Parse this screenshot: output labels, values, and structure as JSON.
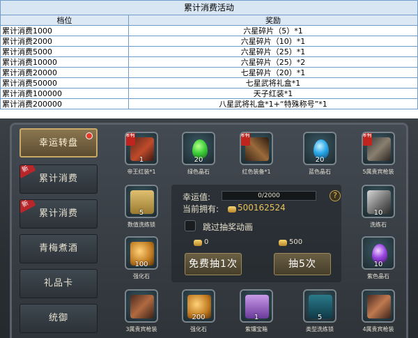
{
  "table": {
    "title": "累计消费活动",
    "headers": [
      "档位",
      "奖励"
    ],
    "rows": [
      {
        "tier": "累计消费1000",
        "reward": "六星碎片（5）*1"
      },
      {
        "tier": "累计消费2000",
        "reward": "六星碎片（10）*1"
      },
      {
        "tier": "累计消费5000",
        "reward": "六星碎片（25）*1"
      },
      {
        "tier": "累计消费10000",
        "reward": "六星碎片（25）*2"
      },
      {
        "tier": "累计消费20000",
        "reward": "七星碎片（20）*1"
      },
      {
        "tier": "累计消费50000",
        "reward": "七星武将礼盒*1"
      },
      {
        "tier": "累计消费100000",
        "reward": "天子红装*1"
      },
      {
        "tier": "累计消费200000",
        "reward": "八星武将礼盒*1+“特殊称号”*1"
      }
    ]
  },
  "sidebar": {
    "items": [
      {
        "label": "幸运转盘",
        "new": false
      },
      {
        "label": "累计消费",
        "new": true
      },
      {
        "label": "累计消费",
        "new": true
      },
      {
        "label": "青梅煮酒",
        "new": false
      },
      {
        "label": "礼品卡",
        "new": false
      },
      {
        "label": "统御",
        "new": false
      }
    ]
  },
  "slots": [
    {
      "name": "帝王红装*1",
      "count": "1",
      "limited": true,
      "tag": "稀有"
    },
    {
      "name": "绿色晶石",
      "count": "20",
      "limited": false,
      "tag": ""
    },
    {
      "name": "红色装备*1",
      "count": "",
      "limited": true,
      "tag": "稀有"
    },
    {
      "name": "蓝色晶石",
      "count": "20",
      "limited": false,
      "tag": ""
    },
    {
      "name": "5属贵宾枪装",
      "count": "",
      "limited": true,
      "tag": "稀有"
    },
    {
      "name": "数值洗练锁",
      "count": "5",
      "limited": false,
      "tag": ""
    },
    {
      "name": "洗练石",
      "count": "10",
      "limited": false,
      "tag": ""
    },
    {
      "name": "强化石",
      "count": "100",
      "limited": false,
      "tag": ""
    },
    {
      "name": "紫色晶石",
      "count": "10",
      "limited": false,
      "tag": ""
    },
    {
      "name": "3属贵宾枪装",
      "count": "",
      "limited": false,
      "tag": ""
    },
    {
      "name": "强化石",
      "count": "200",
      "limited": false,
      "tag": ""
    },
    {
      "name": "紫镶宝箱",
      "count": "1",
      "limited": false,
      "tag": ""
    },
    {
      "name": "类型洗练锁",
      "count": "5",
      "limited": false,
      "tag": ""
    },
    {
      "name": "4属贵宾枪装",
      "count": "",
      "limited": false,
      "tag": ""
    }
  ],
  "center": {
    "luck_label": "幸运值:",
    "luck_value": "0/2000",
    "owned_label": "当前拥有:",
    "owned_value": "500162524",
    "skip_label": "跳过抽奖动画",
    "cost_free": "0",
    "cost_five": "500",
    "free_button": "免费抽1次",
    "five_button": "抽5次",
    "help": "?"
  },
  "colors": {
    "gem_green": "#3ecf3a",
    "gem_blue": "#2aa8e8",
    "gem_purple": "#9a46e0",
    "gold": "#e9c258",
    "accent": "#c9a965"
  }
}
